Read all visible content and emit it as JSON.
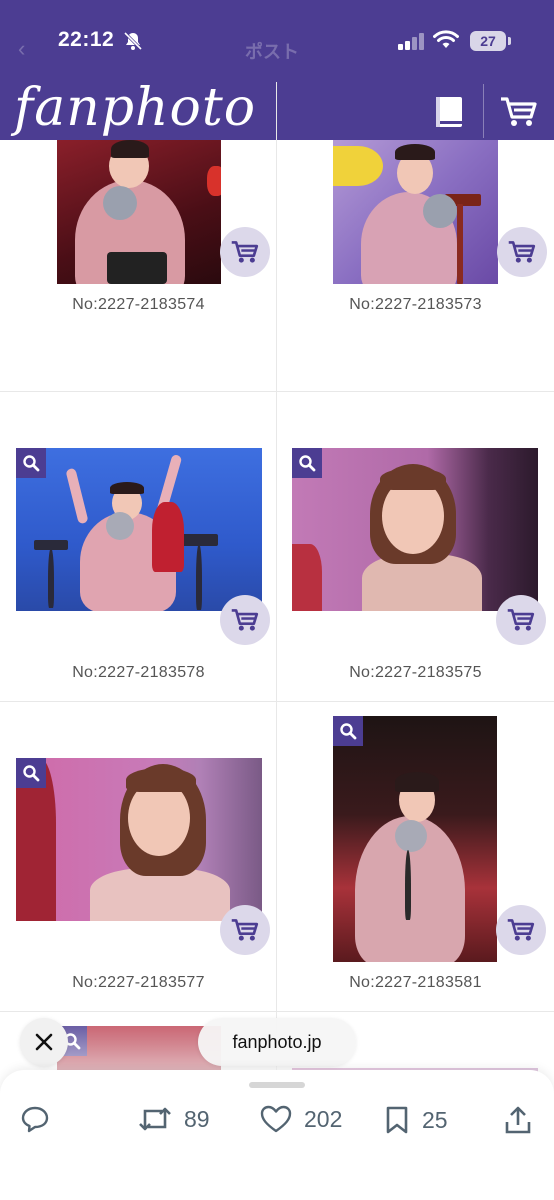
{
  "status_bar": {
    "time": "22:12",
    "battery": "27"
  },
  "nav_ghost": {
    "title": "ポスト"
  },
  "header": {
    "logo": "fanphoto"
  },
  "photos": [
    {
      "number": "No:2227-2183574"
    },
    {
      "number": "No:2227-2183573"
    },
    {
      "number": "No:2227-2183578"
    },
    {
      "number": "No:2227-2183575"
    },
    {
      "number": "No:2227-2183577"
    },
    {
      "number": "No:2227-2183581"
    }
  ],
  "overlay": {
    "url": "fanphoto.jp"
  },
  "actions": {
    "retweets": "89",
    "likes": "202",
    "bookmarks": "25"
  },
  "colors": {
    "brand": "#4c3d92",
    "cart_bg": "#dcd8ea"
  }
}
